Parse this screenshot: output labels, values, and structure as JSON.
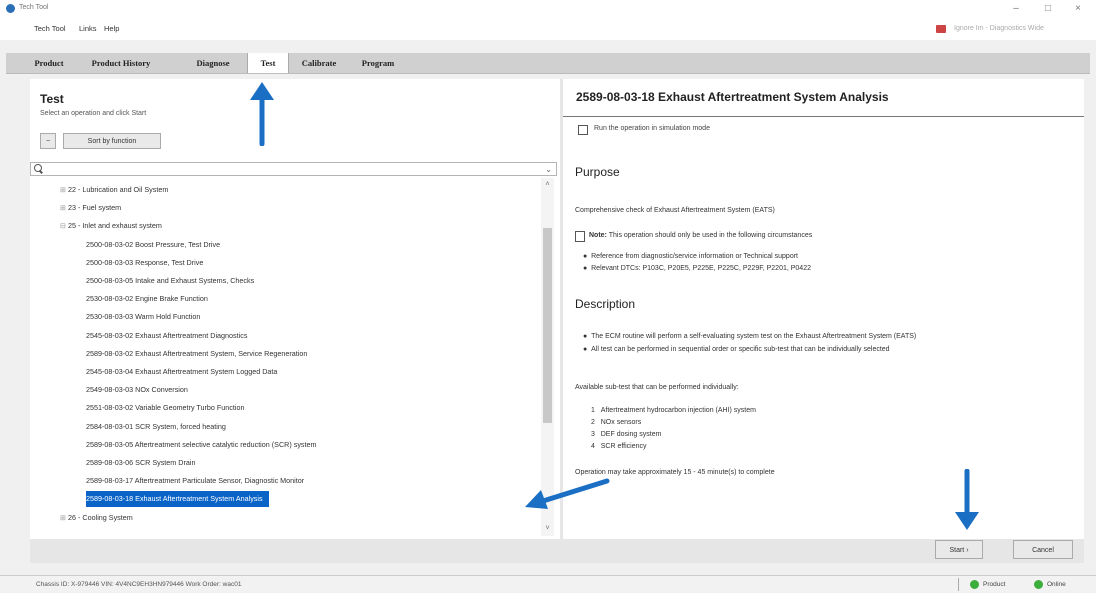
{
  "window": {
    "title": "Tech Tool"
  },
  "menu": {
    "items": [
      "Tech Tool",
      "Links",
      "Help"
    ]
  },
  "user": {
    "name": "Ignore Im - Diagnostics Wide"
  },
  "tabs": [
    "Product",
    "Product History",
    "Diagnose",
    "Test",
    "Calibrate",
    "Program"
  ],
  "active_tab": "Test",
  "left": {
    "title": "Test",
    "subtitle": "Select an operation and click Start",
    "collapse_label": "−",
    "sort_button": "Sort by function",
    "search_placeholder": "",
    "tree": [
      {
        "label": "22 - Lubrication and Oil System",
        "type": "group"
      },
      {
        "label": "23 - Fuel system",
        "type": "group"
      },
      {
        "label": "25 - Inlet and exhaust system",
        "type": "group-open"
      },
      {
        "label": "2500-08-03-02 Boost Pressure, Test Drive",
        "type": "leaf"
      },
      {
        "label": "2500-08-03-03 Response, Test Drive",
        "type": "leaf"
      },
      {
        "label": "2500-08-03-05 Intake and Exhaust Systems, Checks",
        "type": "leaf"
      },
      {
        "label": "2530-08-03-02 Engine Brake Function",
        "type": "leaf"
      },
      {
        "label": "2530-08-03-03 Warm Hold Function",
        "type": "leaf"
      },
      {
        "label": "2545-08-03-02 Exhaust Aftertreatment Diagnostics",
        "type": "leaf"
      },
      {
        "label": "2589-08-03-02 Exhaust Aftertreatment System, Service Regeneration",
        "type": "leaf"
      },
      {
        "label": "2545-08-03-04 Exhaust Aftertreatment System Logged Data",
        "type": "leaf"
      },
      {
        "label": "2549-08-03-03 NOx Conversion",
        "type": "leaf"
      },
      {
        "label": "2551-08-03-02 Variable Geometry Turbo Function",
        "type": "leaf"
      },
      {
        "label": "2584-08-03-01 SCR System, forced heating",
        "type": "leaf"
      },
      {
        "label": "2589-08-03-05 Aftertreatment selective catalytic reduction (SCR) system",
        "type": "leaf"
      },
      {
        "label": "2589-08-03-06 SCR System Drain",
        "type": "leaf"
      },
      {
        "label": "2589-08-03-17 Aftertreatment Particulate Sensor, Diagnostic Monitor",
        "type": "leaf"
      },
      {
        "label": "2589-08-03-18 Exhaust Aftertreatment System Analysis",
        "type": "selected"
      },
      {
        "label": "26 - Cooling System",
        "type": "group"
      }
    ]
  },
  "right": {
    "title": "2589-08-03-18 Exhaust Aftertreatment System Analysis",
    "sim_label": "Run the operation in simulation mode",
    "purpose_heading": "Purpose",
    "purpose_text": "Comprehensive check of Exhaust Aftertreatment System (EATS)",
    "note_label": "Note:",
    "note_text": "This operation should only be used in the following circumstances",
    "note_bullets": [
      "Reference from diagnostic/service information or Technical support",
      "Relevant DTCs: P103C, P20E5, P225E, P225C, P229F, P2201, P0422"
    ],
    "description_heading": "Description",
    "desc_bullets": [
      "The ECM routine will perform a self-evaluating system test on the Exhaust Aftertreatment System (EATS)",
      "All test can be performed in sequential order or specific sub-test that can be individually selected"
    ],
    "subtests_intro": "Available sub-test that can be performed individually:",
    "subtests": [
      {
        "n": "1",
        "label": "Aftertreatment hydrocarbon injection (AHI) system"
      },
      {
        "n": "2",
        "label": "NOx sensors"
      },
      {
        "n": "3",
        "label": "DEF dosing system"
      },
      {
        "n": "4",
        "label": "SCR efficiency"
      }
    ],
    "duration": "Operation may take approximately 15 - 45 minute(s) to complete"
  },
  "buttons": {
    "start": "Start ›",
    "cancel": "Cancel"
  },
  "status": {
    "info": "Chassis ID: X-979446   VIN: 4V4NC9EH3HN979446   Work Order: wac01",
    "product": "Product",
    "online": "Online"
  },
  "colors": {
    "selection": "#0a64c8",
    "arrow": "#1a6fc4",
    "status_ok": "#3cae3c"
  }
}
